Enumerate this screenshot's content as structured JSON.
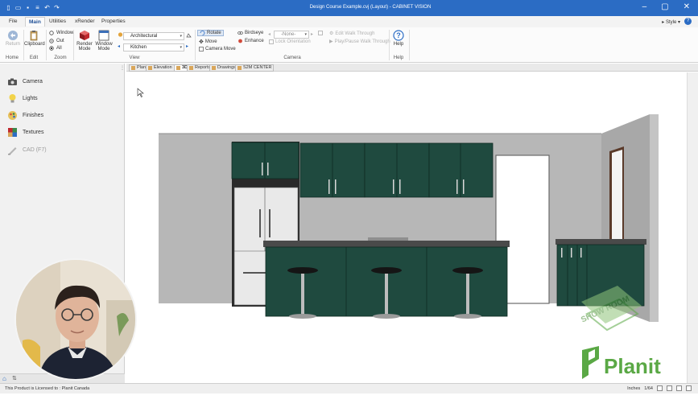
{
  "window": {
    "title": "Design Course Example.cvj (Layout) - CABINET VISION"
  },
  "ribbon_tabs": [
    {
      "label": "File"
    },
    {
      "label": "Main"
    },
    {
      "label": "Utilities"
    },
    {
      "label": "xRender"
    },
    {
      "label": "Properties"
    }
  ],
  "style_menu": "Style",
  "groups": {
    "home": "Home",
    "edit": "Edit",
    "zoom": "Zoom",
    "view": "View",
    "camera": "Camera",
    "help": "Help"
  },
  "buttons": {
    "return": "Return",
    "clipboard": "Clipboard",
    "window": "Window",
    "out": "Out",
    "all": "All",
    "render_mode": "Render Mode",
    "window_mode": "Window Mode",
    "view_combo": "Architectural",
    "room_combo": "Kitchen",
    "rotate": "Rotate",
    "move": "Move",
    "camera_move": "Camera Move",
    "birdseye": "Birdseye",
    "enhance": "Enhance",
    "camera_combo": "-None-",
    "lock_orientation": "Lock Orientation",
    "edit_walk": "Edit Walk Through",
    "play_walk": "Play/Pause Walk Through",
    "help": "Help"
  },
  "left_panel": [
    {
      "label": "Camera",
      "icon": "camera-icon"
    },
    {
      "label": "Lights",
      "icon": "lightbulb-icon"
    },
    {
      "label": "Finishes",
      "icon": "finishes-icon"
    },
    {
      "label": "Textures",
      "icon": "textures-icon"
    },
    {
      "label": "CAD (F7)",
      "icon": "cad-icon"
    }
  ],
  "doc_tabs": [
    {
      "label": "Plan"
    },
    {
      "label": "Elevation"
    },
    {
      "label": "3D"
    },
    {
      "label": "Reports"
    },
    {
      "label": "Drawings"
    },
    {
      "label": "S2M CENTER"
    }
  ],
  "watermarks": {
    "planit": "Planit",
    "showroom": "SHOW ROOM"
  },
  "status": {
    "license": "This Product is Licensed to : Planit Canada",
    "units": "Inches",
    "scale": "1/64"
  },
  "colors": {
    "title_bar": "#2b6cc4",
    "cabinet": "#1f4a3f",
    "countertop": "#4a4a4a",
    "planit_green": "#5aa845"
  }
}
